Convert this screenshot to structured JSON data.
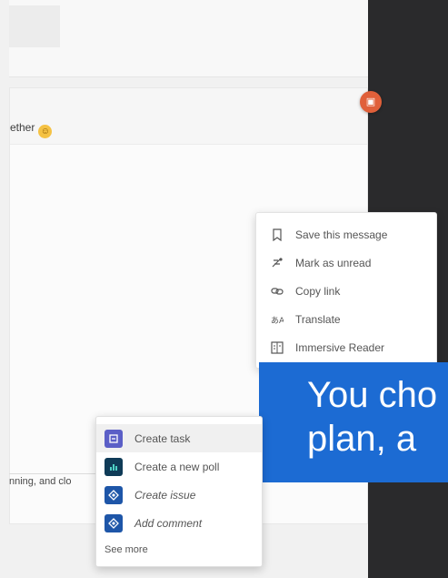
{
  "message": {
    "text": "ether"
  },
  "compose": {
    "text": "nning, and clo"
  },
  "context_menu": {
    "items": [
      {
        "label": "Save this message",
        "icon": "bookmark-icon"
      },
      {
        "label": "Mark as unread",
        "icon": "mark-unread-icon"
      },
      {
        "label": "Copy link",
        "icon": "link-icon"
      },
      {
        "label": "Translate",
        "icon": "translate-icon"
      },
      {
        "label": "Immersive Reader",
        "icon": "immersive-reader-icon"
      }
    ]
  },
  "banner": {
    "line1": "You cho",
    "line2": "plan, a",
    "color": "#1c6bd3"
  },
  "extensions_menu": {
    "items": [
      {
        "label": "Create task",
        "icon": "planner-icon",
        "color": "#5b5fc7"
      },
      {
        "label": "Create a new poll",
        "icon": "poll-icon",
        "color": "#0f3b57"
      },
      {
        "label": "Create issue",
        "icon": "jira-icon",
        "color": "#1e56a8"
      },
      {
        "label": "Add comment",
        "icon": "jira-icon",
        "color": "#1e56a8"
      }
    ],
    "see_more": "See more"
  }
}
